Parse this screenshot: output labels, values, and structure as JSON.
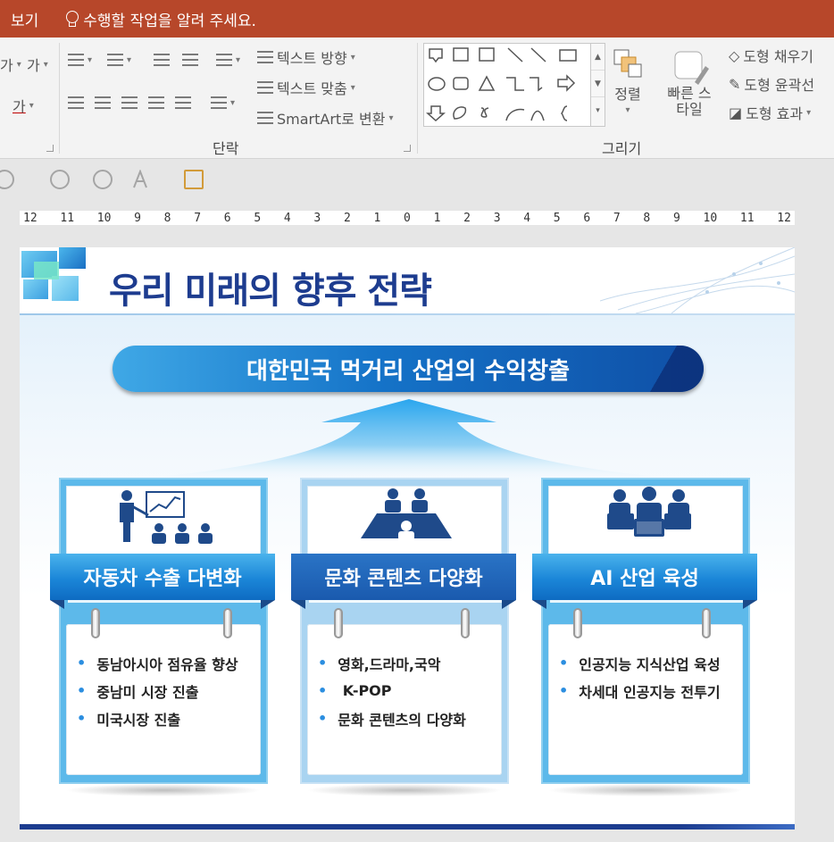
{
  "topbar": {
    "tab_view": "보기",
    "tell_me": "수행할 작업을 알려 주세요."
  },
  "ribbon": {
    "paragraph": {
      "label": "단락",
      "text_direction": "텍스트 방향",
      "align_text": "텍스트 맞춤",
      "smartart": "SmartArt로 변환",
      "font_glyph_1": "가",
      "font_glyph_2": "가",
      "font_glyph_3": "가"
    },
    "drawing": {
      "label": "그리기",
      "arrange": "정렬",
      "quick_styles": "빠른 스타일",
      "shape_fill": "도형 채우기",
      "shape_outline": "도형 윤곽선",
      "shape_effects": "도형 효과"
    }
  },
  "ruler": {
    "ticks": [
      "12",
      "11",
      "10",
      "9",
      "8",
      "7",
      "6",
      "5",
      "4",
      "3",
      "2",
      "1",
      "0",
      "1",
      "2",
      "3",
      "4",
      "5",
      "6",
      "7",
      "8",
      "9",
      "10",
      "11",
      "12"
    ]
  },
  "slide": {
    "title": "우리 미래의 향후 전략",
    "goal": "대한민국 먹거리 산업의 수익창출",
    "columns": [
      {
        "heading": "자동차 수출 다변화",
        "items": [
          "동남아시아 점유율 향상",
          "중남미 시장 진출",
          "미국시장 진출"
        ],
        "icon": "presentation-icon"
      },
      {
        "heading": "문화 콘텐츠 다양화",
        "items": [
          "영화,드라마,국악",
          " K-POP",
          "문화 콘텐츠의 다양화"
        ],
        "icon": "meeting-icon"
      },
      {
        "heading": "AI 산업 육성",
        "items": [
          "인공지능 지식산업 육성",
          "차세대 인공지능 전투기"
        ],
        "icon": "team-laptops-icon"
      }
    ]
  },
  "colors": {
    "titlebar": "#b7472a",
    "title_text": "#1d3c8f",
    "banner": "#1b86d8",
    "accent": "#2b8ee0"
  }
}
